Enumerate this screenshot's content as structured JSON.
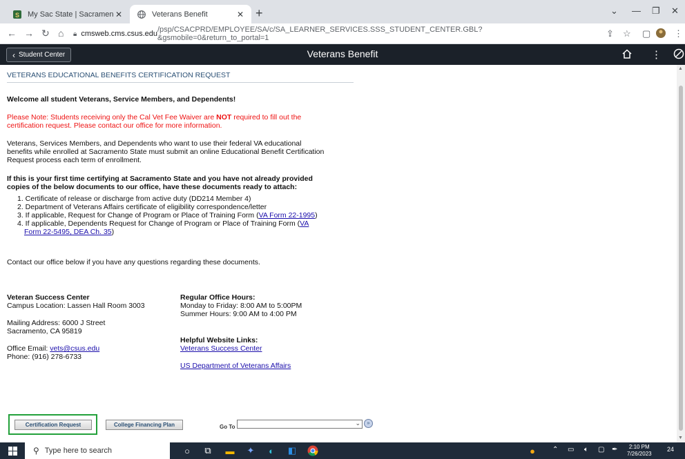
{
  "browser": {
    "tabs": [
      {
        "title": "My Sac State | Sacramento State",
        "close": "✕"
      },
      {
        "title": "Veterans Benefit",
        "close": "✕"
      }
    ],
    "new_tab": "+",
    "url_host": "cmsweb.cms.csus.edu",
    "url_path": "/psp/CSACPRD/EMPLOYEE/SA/c/SA_LEARNER_SERVICES.SSS_STUDENT_CENTER.GBL?&gsmobile=0&return_to_portal=1"
  },
  "app_header": {
    "back_label": "Student Center",
    "title": "Veterans Benefit"
  },
  "page": {
    "heading": "VETERANS EDUCATIONAL BENEFITS CERTIFICATION REQUEST",
    "welcome": "Welcome all student Veterans, Service Members, and Dependents!",
    "note_a": "Please Note: Students receiving only the Cal Vet Fee Waiver are ",
    "note_not": "NOT",
    "note_b": " required to fill out the",
    "note_line2": "certification request.  Please contact our office for more information.",
    "intro_line1": "Veterans, Services Members, and Dependents who want to use their federal VA educational",
    "intro_line2": "benefits while enrolled at Sacramento State must submit an online Educational Benefit Certification",
    "intro_line3": "Request process each term of enrollment.",
    "first_time_line1": "If this is your first time certifying at Sacramento State and you have not already provided",
    "first_time_line2": "copies of the below documents to our office, have these documents ready to attach:",
    "docs": {
      "item1": "1. Certificate of release or discharge from active duty (DD214 Member 4)",
      "item2": "2. Department of Veterans Affairs certificate of eligibility correspondence/letter",
      "item3_text": "3. If applicable, Request for Change of Program or Place of Training Form (",
      "item3_link": "VA Form 22-1995",
      "item3_end": ")",
      "item4_text": "4. If applicable, Dependents Request for Change of Program or Place of Training Form (",
      "item4_link_a": "VA",
      "item4_link_b": "Form 22-5495, DEA Ch. 35",
      "item4_end": ")"
    },
    "contact_note": "Contact our office below if you have any questions regarding these documents.",
    "center": {
      "name": "Veteran Success Center",
      "campus": "Campus Location: Lassen Hall Room 3003",
      "mailing1": "Mailing Address: 6000 J Street",
      "mailing2": "Sacramento, CA 95819",
      "email_label": "Office Email: ",
      "email": "vets@csus.edu",
      "phone": "Phone: (916) 278-6733"
    },
    "hours": {
      "title": "Regular Office Hours:",
      "weekday": "Monday to Friday: 8:00 AM to 5:00PM",
      "summer": "Summer Hours: 9:00 AM to 4:00 PM"
    },
    "links": {
      "title": "Helpful Website Links:",
      "vsc": "Veterans Success Center",
      "usva": "US Department of Veterans Affairs"
    },
    "buttons": {
      "cert": "Certification Request",
      "financing": "College Financing Plan",
      "goto_label": "Go To",
      "goto_value": "",
      "go": "»"
    }
  },
  "taskbar": {
    "search_placeholder": "Type here to search",
    "time": "2:10 PM",
    "date": "7/26/2023",
    "notif_count": "24"
  }
}
